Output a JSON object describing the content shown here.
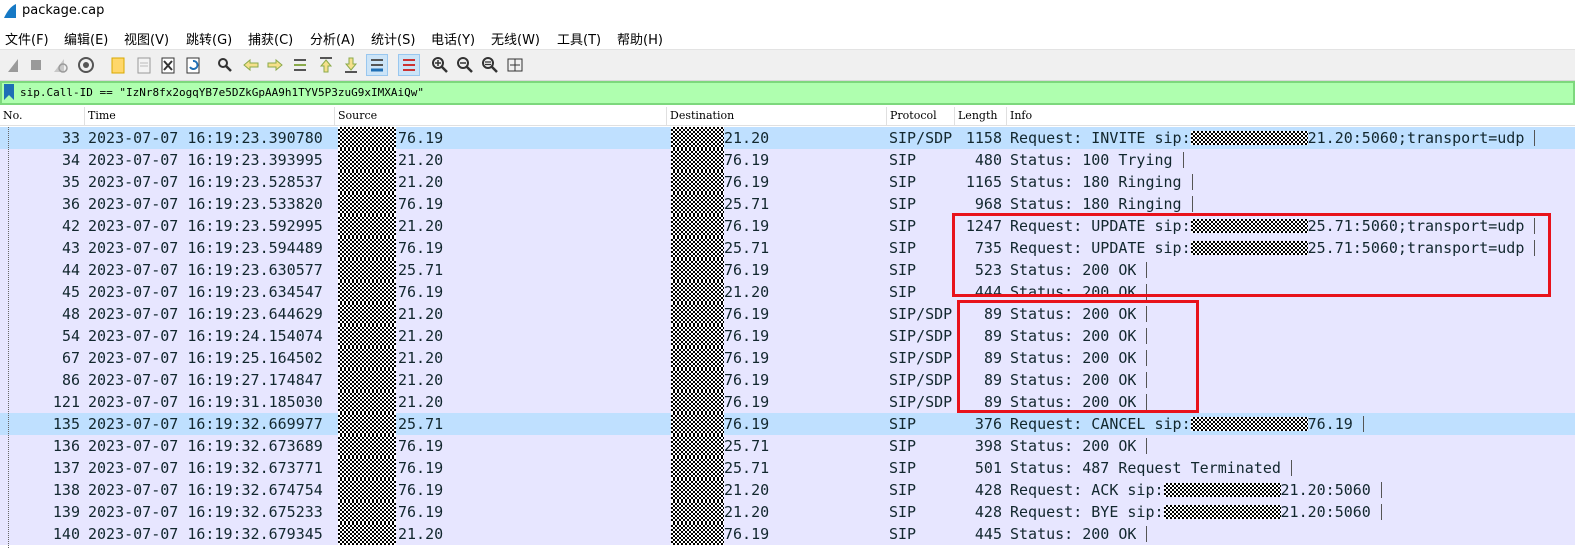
{
  "window": {
    "title": "package.cap"
  },
  "menu": [
    "文件(F)",
    "编辑(E)",
    "视图(V)",
    "跳转(G)",
    "捕获(C)",
    "分析(A)",
    "统计(S)",
    "电话(Y)",
    "无线(W)",
    "工具(T)",
    "帮助(H)"
  ],
  "toolbar": {
    "icons": [
      "start-capture-icon",
      "stop-capture-icon",
      "restart-capture-icon",
      "capture-options-icon",
      "open-file-icon",
      "save-file-icon",
      "close-file-icon",
      "reload-file-icon",
      "find-packet-icon",
      "go-back-icon",
      "go-forward-icon",
      "go-to-packet-icon",
      "go-first-packet-icon",
      "go-last-packet-icon",
      "auto-scroll-icon",
      "colorize-icon",
      "zoom-in-icon",
      "zoom-out-icon",
      "zoom-normal-icon",
      "resize-columns-icon"
    ]
  },
  "filter": {
    "value": "sip.Call-ID == \"IzNr8fx2ogqYB7e5DZkGpAA9h1TYV5P3zuG9xIMXAiQw\""
  },
  "columns": {
    "no": "No.",
    "time": "Time",
    "source": "Source",
    "destination": "Destination",
    "protocol": "Protocol",
    "length": "Length",
    "info": "Info"
  },
  "colors": {
    "row_bg": "#e7e6ff",
    "selected_row_bg": "#bfe0ff",
    "filter_bg": "#afffaf",
    "highlight_box": "#e8121b"
  },
  "packets": [
    {
      "no": "33",
      "time": "2023-07-07 16:19:23.390780",
      "source": "76.19",
      "destination": "21.20",
      "protocol": "SIP/SDP",
      "length": "1158",
      "info_pre": "Request: INVITE sip:",
      "info_post": "21.20:5060;transport=udp",
      "selected": true
    },
    {
      "no": "34",
      "time": "2023-07-07 16:19:23.393995",
      "source": "21.20",
      "destination": "76.19",
      "protocol": "SIP",
      "length": "480",
      "info": "Status: 100 Trying"
    },
    {
      "no": "35",
      "time": "2023-07-07 16:19:23.528537",
      "source": "21.20",
      "destination": "76.19",
      "protocol": "SIP",
      "length": "1165",
      "info": "Status: 180 Ringing"
    },
    {
      "no": "36",
      "time": "2023-07-07 16:19:23.533820",
      "source": "76.19",
      "destination": "25.71",
      "protocol": "SIP",
      "length": "968",
      "info": "Status: 180 Ringing"
    },
    {
      "no": "42",
      "time": "2023-07-07 16:19:23.592995",
      "source": "21.20",
      "destination": "76.19",
      "protocol": "SIP",
      "length": "1247",
      "info_pre": "Request: UPDATE sip:",
      "info_post": "25.71:5060;transport=udp"
    },
    {
      "no": "43",
      "time": "2023-07-07 16:19:23.594489",
      "source": "76.19",
      "destination": "25.71",
      "protocol": "SIP",
      "length": "735",
      "info_pre": "Request: UPDATE sip:",
      "info_post": "25.71:5060;transport=udp"
    },
    {
      "no": "44",
      "time": "2023-07-07 16:19:23.630577",
      "source": "25.71",
      "destination": "76.19",
      "protocol": "SIP",
      "length": "523",
      "info": "Status: 200 OK"
    },
    {
      "no": "45",
      "time": "2023-07-07 16:19:23.634547",
      "source": "76.19",
      "destination": "21.20",
      "protocol": "SIP",
      "length": "444",
      "info": "Status: 200 OK"
    },
    {
      "no": "48",
      "time": "2023-07-07 16:19:23.644629",
      "source": "21.20",
      "destination": "76.19",
      "protocol": "SIP/SDP",
      "length": "89",
      "info": "Status: 200 OK"
    },
    {
      "no": "54",
      "time": "2023-07-07 16:19:24.154074",
      "source": "21.20",
      "destination": "76.19",
      "protocol": "SIP/SDP",
      "length": "89",
      "info": "Status: 200 OK"
    },
    {
      "no": "67",
      "time": "2023-07-07 16:19:25.164502",
      "source": "21.20",
      "destination": "76.19",
      "protocol": "SIP/SDP",
      "length": "89",
      "info": "Status: 200 OK"
    },
    {
      "no": "86",
      "time": "2023-07-07 16:19:27.174847",
      "source": "21.20",
      "destination": "76.19",
      "protocol": "SIP/SDP",
      "length": "89",
      "info": "Status: 200 OK"
    },
    {
      "no": "121",
      "time": "2023-07-07 16:19:31.185030",
      "source": "21.20",
      "destination": "76.19",
      "protocol": "SIP/SDP",
      "length": "89",
      "info": "Status: 200 OK"
    },
    {
      "no": "135",
      "time": "2023-07-07 16:19:32.669977",
      "source": "25.71",
      "destination": "76.19",
      "protocol": "SIP",
      "length": "376",
      "info_pre": "Request: CANCEL sip:",
      "info_post": "76.19",
      "selected": true
    },
    {
      "no": "136",
      "time": "2023-07-07 16:19:32.673689",
      "source": "76.19",
      "destination": "25.71",
      "protocol": "SIP",
      "length": "398",
      "info": "Status: 200 OK"
    },
    {
      "no": "137",
      "time": "2023-07-07 16:19:32.673771",
      "source": "76.19",
      "destination": "25.71",
      "protocol": "SIP",
      "length": "501",
      "info": "Status: 487 Request Terminated"
    },
    {
      "no": "138",
      "time": "2023-07-07 16:19:32.674754",
      "source": "76.19",
      "destination": "21.20",
      "protocol": "SIP",
      "length": "428",
      "info_pre": "Request: ACK sip:",
      "info_post": "21.20:5060"
    },
    {
      "no": "139",
      "time": "2023-07-07 16:19:32.675233",
      "source": "76.19",
      "destination": "21.20",
      "protocol": "SIP",
      "length": "428",
      "info_pre": "Request: BYE sip:",
      "info_post": "21.20:5060"
    },
    {
      "no": "140",
      "time": "2023-07-07 16:19:32.679345",
      "source": "21.20",
      "destination": "76.19",
      "protocol": "SIP",
      "length": "445",
      "info": "Status: 200 OK"
    }
  ]
}
